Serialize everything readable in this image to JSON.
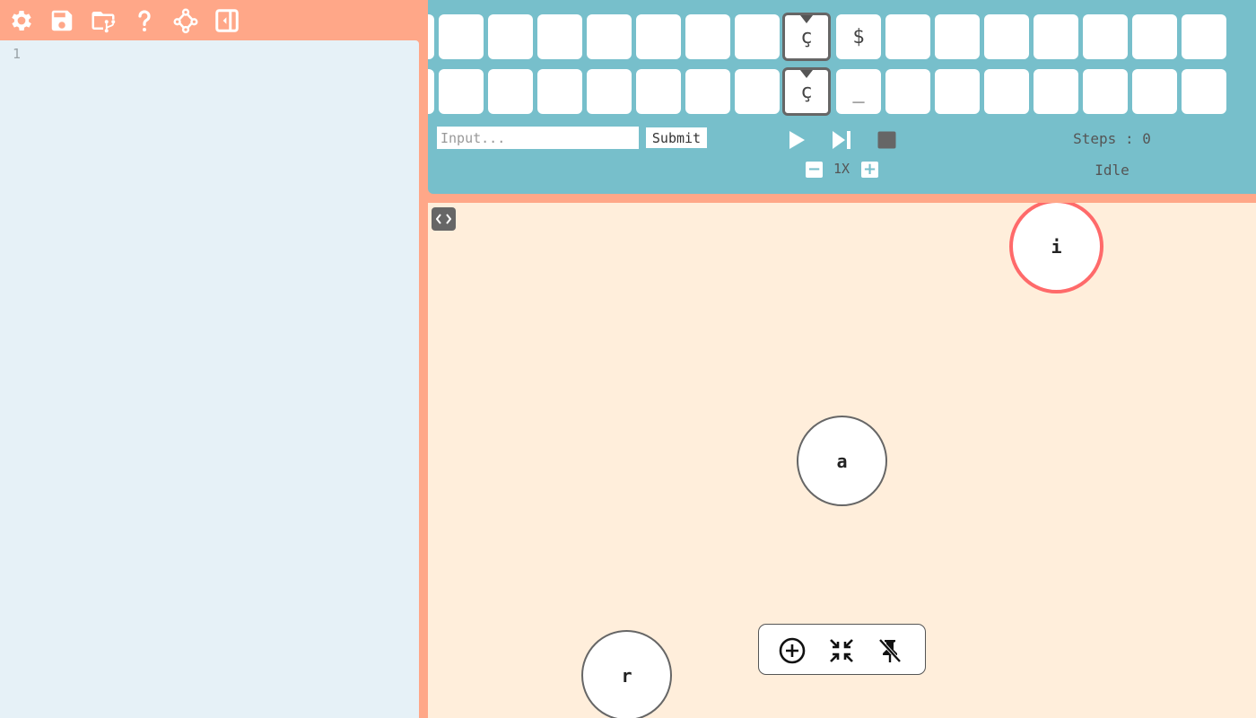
{
  "toolbar": {
    "icons": [
      "gear-icon",
      "save-icon",
      "folder-branch-icon",
      "help-icon",
      "graph-icon",
      "collapse-panel-icon"
    ]
  },
  "editor": {
    "line_numbers": [
      "1"
    ],
    "content": ""
  },
  "tapes": [
    {
      "cells": [
        "",
        "",
        "",
        "",
        "",
        "",
        "",
        "",
        "ç",
        "$",
        "",
        "",
        "",
        "",
        "",
        "",
        ""
      ],
      "head_index": 8
    },
    {
      "cells": [
        "",
        "",
        "",
        "",
        "",
        "",
        "",
        "",
        "ç",
        "_",
        "",
        "",
        "",
        "",
        "",
        "",
        ""
      ],
      "head_index": 8
    }
  ],
  "input": {
    "placeholder": "Input...",
    "value": ""
  },
  "submit_label": "Submit",
  "controls": {
    "play": "play-icon",
    "step": "step-forward-icon",
    "stop": "stop-icon"
  },
  "speed": {
    "label": "1X",
    "decrease": "−",
    "increase": "+"
  },
  "status": {
    "steps": "Steps : 0",
    "state": "Idle"
  },
  "graph": {
    "nodes": [
      {
        "label": "i",
        "initial": true
      },
      {
        "label": "a",
        "initial": false
      },
      {
        "label": "r",
        "initial": false
      }
    ],
    "tools": [
      "add-state-icon",
      "fit-view-icon",
      "unpin-icon"
    ]
  },
  "colors": {
    "toolbar_bg": "#ffa788",
    "editor_bg": "#e6f1f7",
    "tape_panel_bg": "#77bfcb",
    "canvas_bg": "#ffeedb",
    "initial_node_border": "#ff6a6a"
  }
}
